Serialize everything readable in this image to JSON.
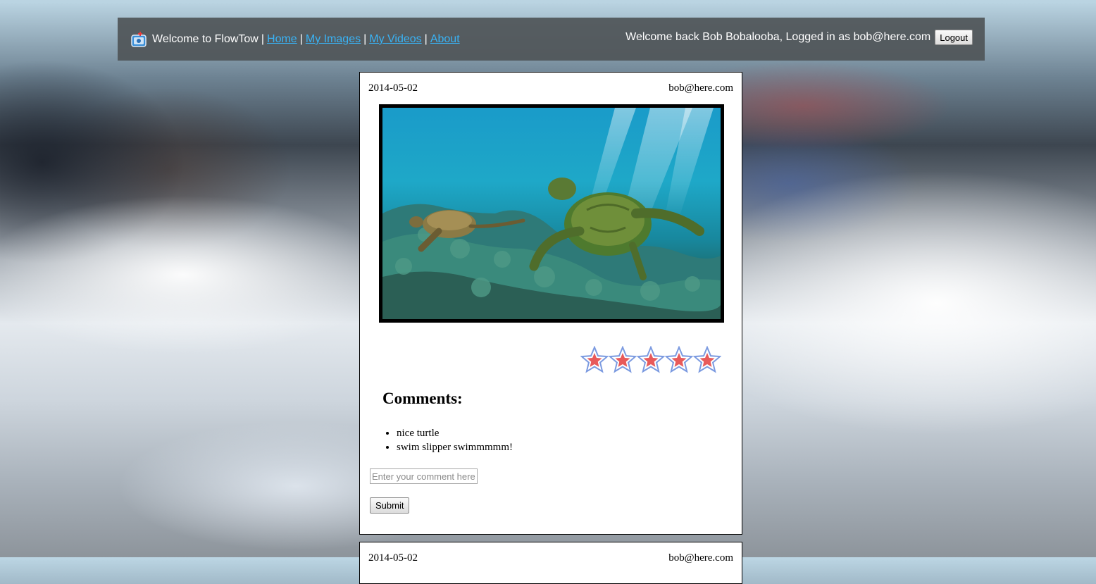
{
  "header": {
    "welcome": "Welcome to FlowTow",
    "sep": "|",
    "nav": [
      {
        "label": "Home"
      },
      {
        "label": "My Images"
      },
      {
        "label": "My Videos"
      },
      {
        "label": "About"
      }
    ],
    "user_text": "Welcome back Bob Bobalooba, Logged in as bob@here.com",
    "logout_label": "Logout",
    "link_color": "#39b3f5"
  },
  "posts": [
    {
      "date": "2014-05-02",
      "author": "bob@here.com",
      "image": "sea-turtles-photo",
      "rating": 5,
      "comments_title": "Comments:",
      "comments": [
        "nice turtle",
        "swim slipper swimmmmm!"
      ],
      "comment_placeholder": "Enter your comment here",
      "submit_label": "Submit"
    },
    {
      "date": "2014-05-02",
      "author": "bob@here.com"
    }
  ],
  "star_color": "#e85a5a",
  "star_outline_color": "#7b9ae0"
}
